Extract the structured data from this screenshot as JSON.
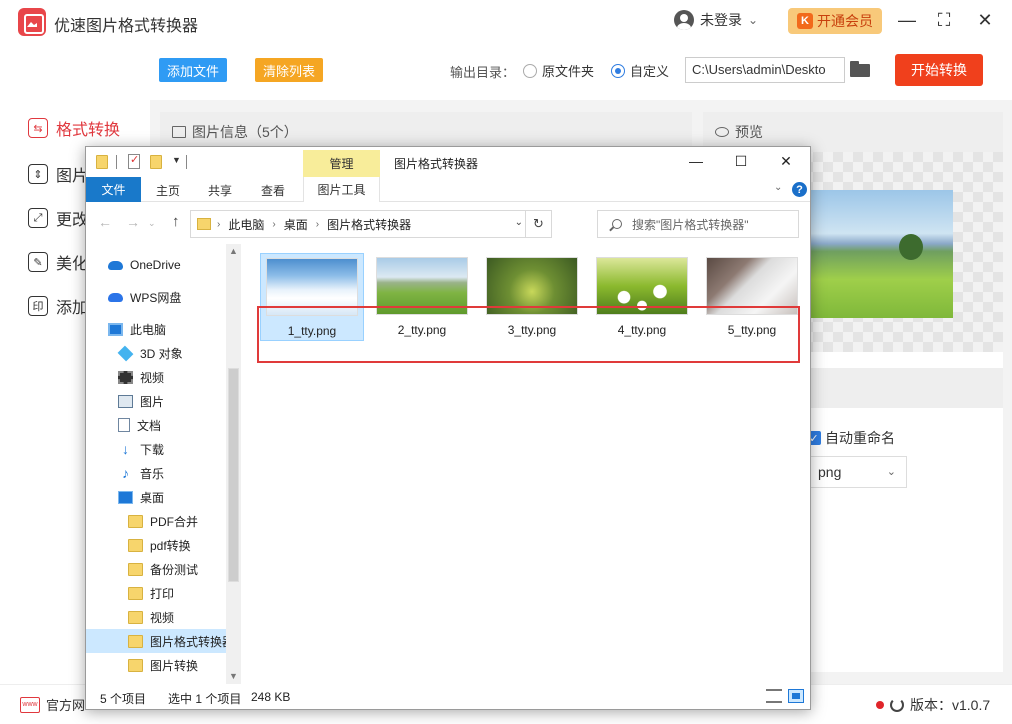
{
  "app": {
    "title": "优速图片格式转换器",
    "user": "未登录",
    "user_chevron": "⌄",
    "vip_badge": "K",
    "vip": "开通会员",
    "window_controls": {
      "minimize": "—",
      "maximize": "⛶",
      "close": "✕"
    },
    "sidebar": [
      {
        "label": "格式转换",
        "glyph": "⇆",
        "icon": "convert-icon",
        "active": true
      },
      {
        "label": "图片",
        "glyph": "⇕",
        "icon": "compress-icon",
        "active": false
      },
      {
        "label": "更改",
        "glyph": "⤢",
        "icon": "resize-icon",
        "active": false
      },
      {
        "label": "美化",
        "glyph": "✎",
        "icon": "beautify-icon",
        "active": false
      },
      {
        "label": "添加",
        "glyph": "印",
        "icon": "watermark-icon",
        "active": false
      }
    ],
    "toolbar": {
      "add_files": "添加文件",
      "clear_list": "清除列表",
      "output_label": "输出目录：",
      "option_original": "原文件夹",
      "option_custom": "自定义",
      "path": "C:\\Users\\admin\\Deskto",
      "start": "开始转换"
    },
    "info_panel_title": "图片信息（5个）",
    "preview_title": "预览",
    "auto_rename": "自动重命名",
    "format_value": "png",
    "format_chevron": "⌄",
    "footer_left": "官方网",
    "footer_web_icon": "www",
    "footer_version": "版本：v1.0.7",
    "colors": {
      "accent_red": "#f0401c",
      "blue_button": "#2f9bf4",
      "orange_button": "#f5a623",
      "explorer_blue": "#1979ca"
    }
  },
  "explorer": {
    "manage_tab": "管理",
    "title": "图片格式转换器",
    "window_controls": {
      "minimize": "—",
      "maximize": "☐",
      "close": "✕"
    },
    "ribbon": {
      "file": "文件",
      "home": "主页",
      "share": "共享",
      "view": "查看",
      "picture_tools": "图片工具",
      "help": "?"
    },
    "nav": {
      "back": "←",
      "forward": "→",
      "up": "↑"
    },
    "breadcrumb": [
      "此电脑",
      "桌面",
      "图片格式转换器"
    ],
    "crumb_sep": "›",
    "address_dropdown": "⌄",
    "address_refresh": "↻",
    "search_placeholder": "搜索\"图片格式转换器\"",
    "scrollbar": {
      "up": "▲",
      "down": "▼"
    },
    "nav_items": [
      {
        "label": "OneDrive",
        "icon": "onedrive-icon",
        "type": "cloud",
        "indent": 22
      },
      {
        "label": "WPS网盘",
        "icon": "wps-cloud-icon",
        "type": "wps",
        "indent": 22
      },
      {
        "label": "此电脑",
        "icon": "computer-icon",
        "type": "pc",
        "indent": 22
      },
      {
        "label": "3D 对象",
        "icon": "3d-objects-icon",
        "type": "3d",
        "indent": 32
      },
      {
        "label": "视频",
        "icon": "videos-icon",
        "type": "video",
        "indent": 32
      },
      {
        "label": "图片",
        "icon": "pictures-icon",
        "type": "pic",
        "indent": 32
      },
      {
        "label": "文档",
        "icon": "documents-icon",
        "type": "doc",
        "indent": 32
      },
      {
        "label": "下载",
        "icon": "downloads-icon",
        "type": "dl",
        "indent": 32
      },
      {
        "label": "音乐",
        "icon": "music-icon",
        "type": "music",
        "indent": 32
      },
      {
        "label": "桌面",
        "icon": "desktop-icon",
        "type": "desk",
        "indent": 32
      },
      {
        "label": "PDF合并",
        "icon": "folder-icon",
        "type": "folder",
        "indent": 42
      },
      {
        "label": "pdf转换",
        "icon": "folder-icon",
        "type": "folder",
        "indent": 42
      },
      {
        "label": "备份测试",
        "icon": "folder-icon",
        "type": "folder",
        "indent": 42
      },
      {
        "label": "打印",
        "icon": "folder-icon",
        "type": "folder",
        "indent": 42
      },
      {
        "label": "视频",
        "icon": "folder-icon",
        "type": "folder",
        "indent": 42
      },
      {
        "label": "图片格式转换器",
        "icon": "folder-icon",
        "type": "folder",
        "indent": 42,
        "selected": true
      },
      {
        "label": "图片转换",
        "icon": "folder-icon",
        "type": "folder",
        "indent": 42
      }
    ],
    "files": [
      {
        "name": "1_tty.png",
        "selected": true
      },
      {
        "name": "2_tty.png",
        "selected": false
      },
      {
        "name": "3_tty.png",
        "selected": false
      },
      {
        "name": "4_tty.png",
        "selected": false
      },
      {
        "name": "5_tty.png",
        "selected": false
      }
    ],
    "status": {
      "count": "5 个项目",
      "selected": "选中 1 个项目",
      "size": "248 KB"
    }
  }
}
